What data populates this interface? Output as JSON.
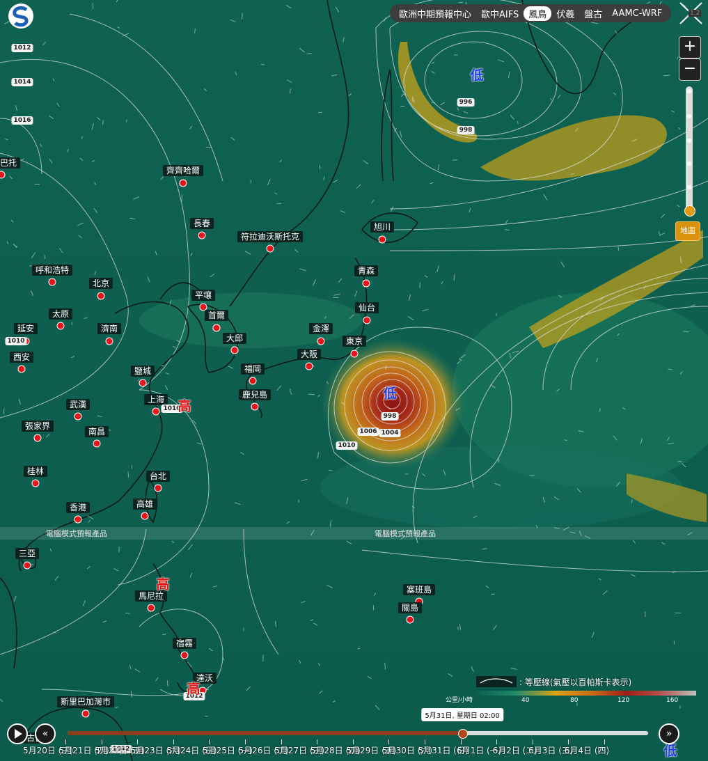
{
  "models": [
    {
      "label": "歐洲中期預報中心",
      "active": false
    },
    {
      "label": "歐中AIFS",
      "active": false
    },
    {
      "label": "風鳥",
      "active": true
    },
    {
      "label": "伏羲",
      "active": false
    },
    {
      "label": "盤古",
      "active": false
    },
    {
      "label": "AAMC-WRF",
      "active": false
    }
  ],
  "zoom": {
    "in_label": "+",
    "out_label": "−"
  },
  "basemap_label": "地圖",
  "fullscreen_badge": "1.2",
  "product_label": "電腦模式預報產品",
  "cities": [
    {
      "name": "齊齊哈爾"
    },
    {
      "name": "長春"
    },
    {
      "name": "符拉迪沃斯托克"
    },
    {
      "name": "旭川"
    },
    {
      "name": "呼和浩特"
    },
    {
      "name": "北京"
    },
    {
      "name": "平壤"
    },
    {
      "name": "青森"
    },
    {
      "name": "太原"
    },
    {
      "name": "首爾"
    },
    {
      "name": "仙台"
    },
    {
      "name": "濟南"
    },
    {
      "name": "延安"
    },
    {
      "name": "大邱"
    },
    {
      "name": "金澤"
    },
    {
      "name": "東京"
    },
    {
      "name": "西安"
    },
    {
      "name": "大阪"
    },
    {
      "name": "鹽城"
    },
    {
      "name": "福岡"
    },
    {
      "name": "上海"
    },
    {
      "name": "鹿兒島"
    },
    {
      "name": "武漢"
    },
    {
      "name": "張家界"
    },
    {
      "name": "南昌"
    },
    {
      "name": "桂林"
    },
    {
      "name": "台北"
    },
    {
      "name": "香港"
    },
    {
      "name": "高雄"
    },
    {
      "name": "三亞"
    },
    {
      "name": "塞班島"
    },
    {
      "name": "關島"
    },
    {
      "name": "馬尼拉"
    },
    {
      "name": "宿霧"
    },
    {
      "name": "達沃"
    },
    {
      "name": "斯里巴加灣市"
    },
    {
      "name": "巴托"
    },
    {
      "name": "古晉"
    }
  ],
  "pressure_labels": [
    "1012",
    "1014",
    "1016",
    "1010",
    "996",
    "998",
    "998",
    "1006",
    "1004",
    "1010",
    "1010",
    "1012",
    "1012"
  ],
  "systems": [
    {
      "label": "低",
      "kind": "low"
    },
    {
      "label": "低",
      "kind": "low"
    },
    {
      "label": "高",
      "kind": "high"
    },
    {
      "label": "高",
      "kind": "high"
    },
    {
      "label": "高",
      "kind": "high"
    },
    {
      "label": "低",
      "kind": "low"
    }
  ],
  "legend": {
    "isobar_label": ": 等壓線(氣壓以百帕斯卡表示)",
    "unit": "公里/小時",
    "ticks": [
      "40",
      "80",
      "120",
      "160"
    ],
    "colors": [
      "#0d5f50",
      "#1f8a68",
      "#d9a41a",
      "#c8711a",
      "#9e1e14",
      "#c0c0c0"
    ]
  },
  "timeline": {
    "current_time": "5月31日, 星期日 02:00",
    "progress": 0.68,
    "days": [
      "5月20日 (三)",
      "5月21日 (四)",
      "5月22日 (五)",
      "5月23日 (六)",
      "5月24日 (日)",
      "5月25日 (一)",
      "5月26日 (二)",
      "5月27日 (三)",
      "5月28日 (四)",
      "5月29日 (五)",
      "5月30日 (六)",
      "5月31日 (日)",
      "6月1日 (一)",
      "6月2日 (二)",
      "6月3日 (三)",
      "6月4日 (四)"
    ]
  }
}
